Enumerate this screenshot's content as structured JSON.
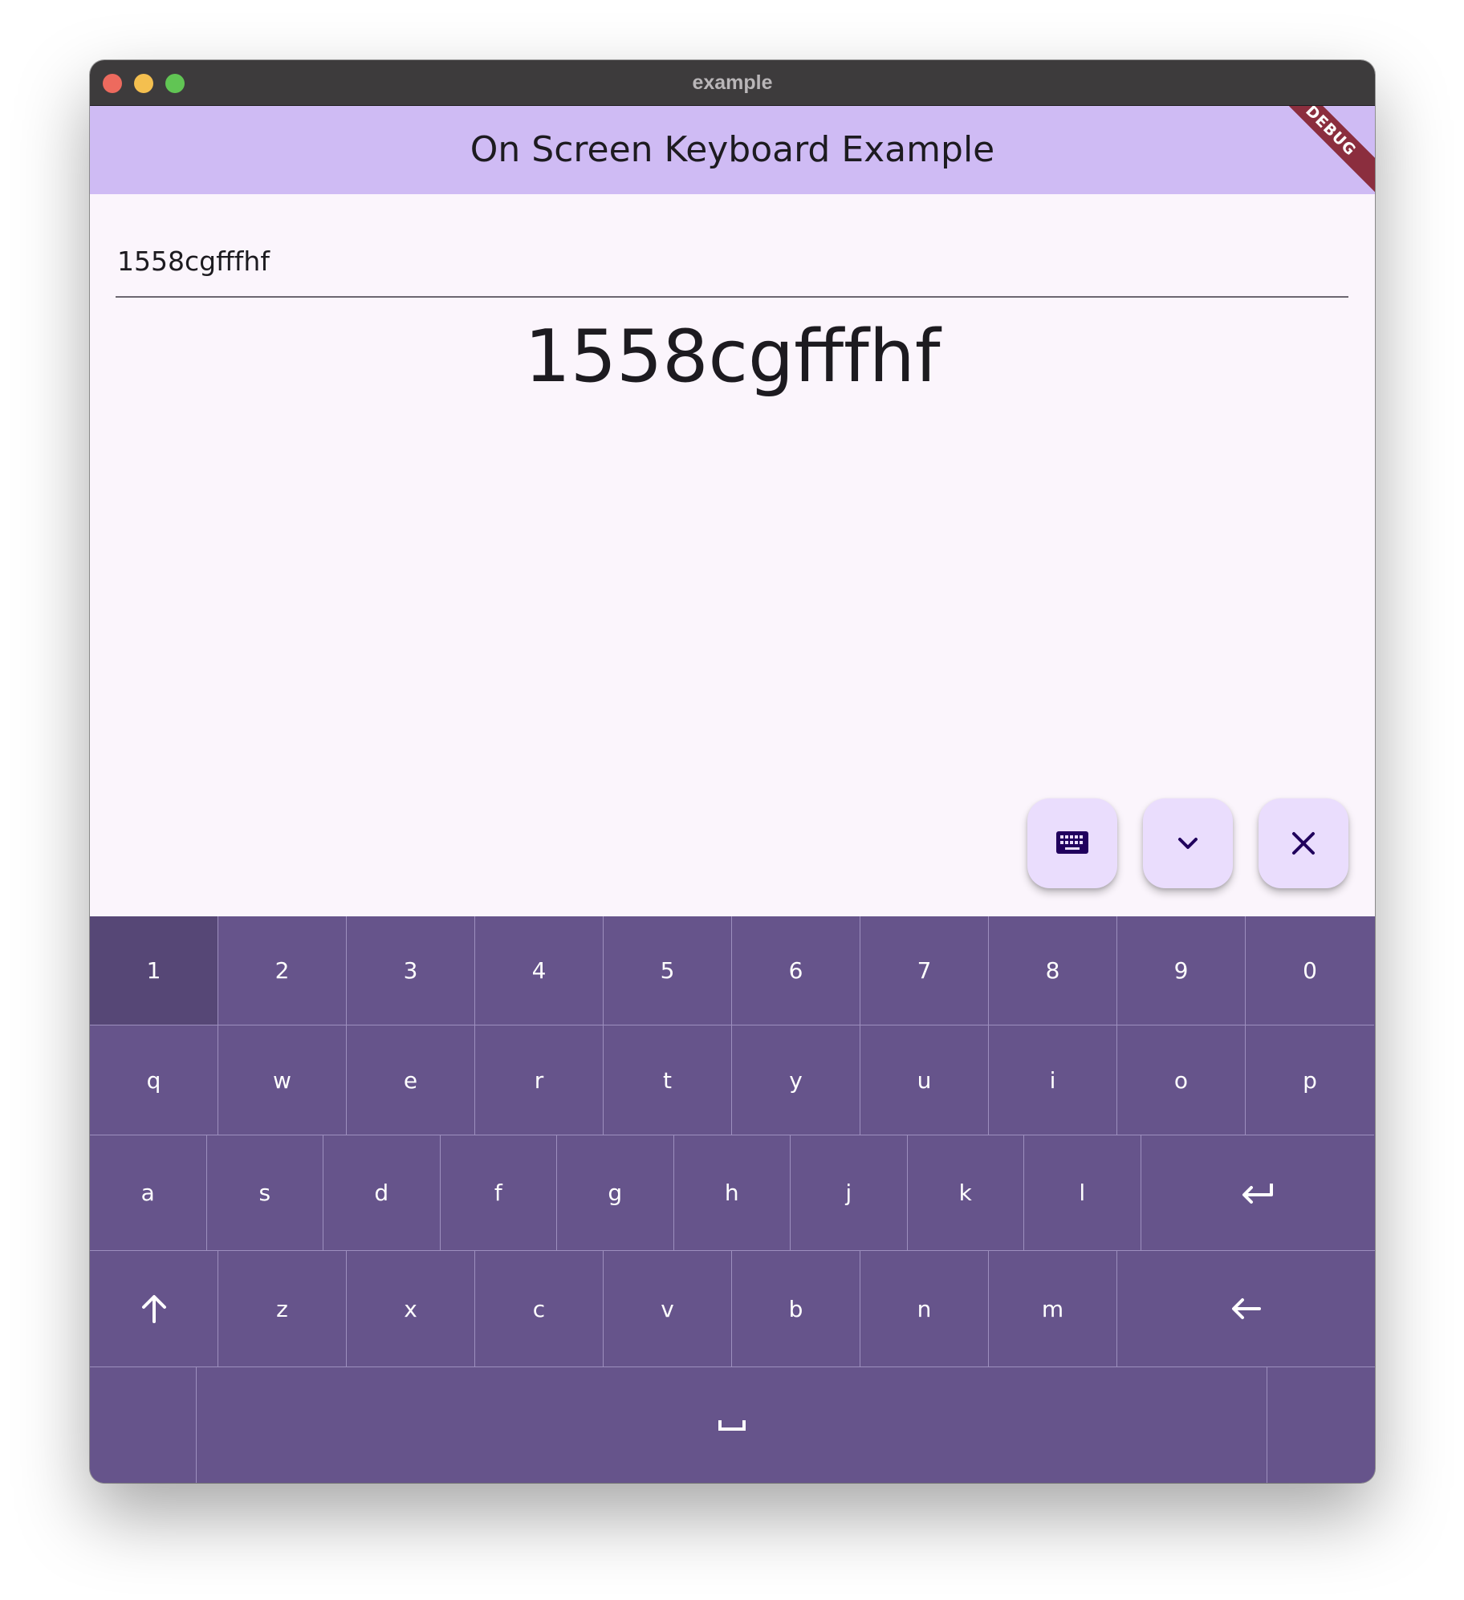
{
  "window": {
    "title": "example"
  },
  "appbar": {
    "title": "On Screen Keyboard Example",
    "debug_banner": "DEBUG"
  },
  "input": {
    "value": "1558cgfffhf"
  },
  "display": {
    "text": "1558cgfffhf"
  },
  "fabs": [
    {
      "icon": "keyboard-icon"
    },
    {
      "icon": "chevron-down-icon"
    },
    {
      "icon": "close-icon"
    }
  ],
  "keyboard": {
    "row1": [
      "1",
      "2",
      "3",
      "4",
      "5",
      "6",
      "7",
      "8",
      "9",
      "0"
    ],
    "row2": [
      "q",
      "w",
      "e",
      "r",
      "t",
      "y",
      "u",
      "i",
      "o",
      "p"
    ],
    "row3": [
      "a",
      "s",
      "d",
      "f",
      "g",
      "h",
      "j",
      "k",
      "l"
    ],
    "row3_action": "enter-icon",
    "row4_left": "shift-icon",
    "row4": [
      "z",
      "x",
      "c",
      "v",
      "b",
      "n",
      "m"
    ],
    "row4_action": "backspace-icon",
    "row5_space": "space-icon",
    "pressed_key": "1"
  },
  "colors": {
    "appbar": "#cfbbf4",
    "background": "#fbf5fc",
    "keyboard": "#66548b",
    "fab": "#eaddfd"
  }
}
